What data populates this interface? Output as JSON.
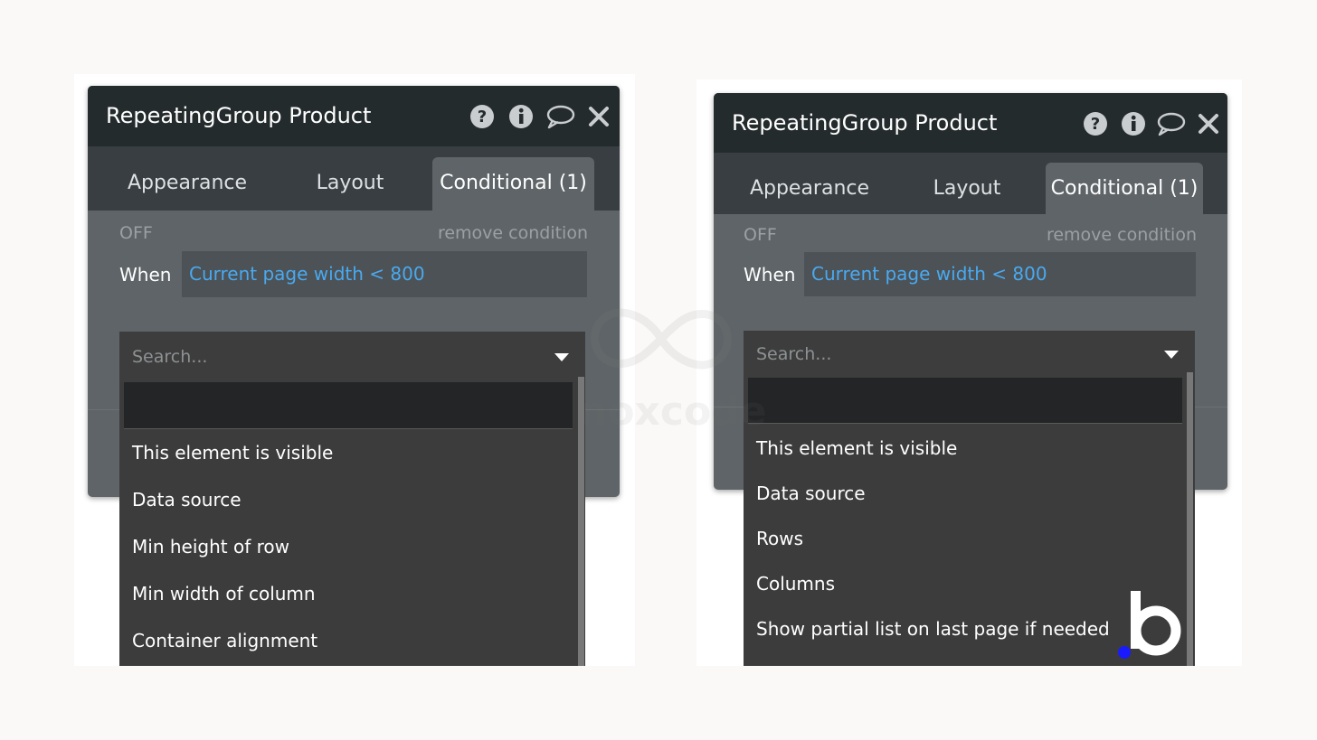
{
  "panels": [
    {
      "title": "RepeatingGroup Product",
      "header_icons": [
        "help-icon",
        "info-icon",
        "comment-icon",
        "close-icon"
      ],
      "tabs": [
        "Appearance",
        "Layout",
        "Conditional (1)"
      ],
      "active_tab": "Conditional (1)",
      "condition": {
        "status": "OFF",
        "remove_label": "remove condition",
        "when_label": "When",
        "expression": "Current page width < 800"
      },
      "dropdown": {
        "placeholder": "Search...",
        "items": [
          "This element is visible",
          "Data source",
          "Min height of row",
          "Min width of column",
          "Container alignment"
        ]
      }
    },
    {
      "title": "RepeatingGroup Product",
      "header_icons": [
        "help-icon",
        "info-icon",
        "comment-icon",
        "close-icon"
      ],
      "tabs": [
        "Appearance",
        "Layout",
        "Conditional (1)"
      ],
      "active_tab": "Conditional (1)",
      "condition": {
        "status": "OFF",
        "remove_label": "remove condition",
        "when_label": "When",
        "expression": "Current page width < 800"
      },
      "dropdown": {
        "placeholder": "Search...",
        "items": [
          "This element is visible",
          "Data source",
          "Rows",
          "Columns",
          "Show partial list on last page if needed"
        ]
      }
    }
  ],
  "watermark": {
    "text": "noxcode",
    "icon": "infinity-logo"
  },
  "brand_logo": {
    "icon": "bubble-logo",
    "dot_color": "#1a1aff"
  },
  "colors": {
    "header_bg": "#242b2d",
    "tab_bar_bg": "#383e41",
    "panel_bg": "#5e6467",
    "expression_text": "#4aa9f0",
    "dropdown_bg": "#3c3c3c"
  }
}
